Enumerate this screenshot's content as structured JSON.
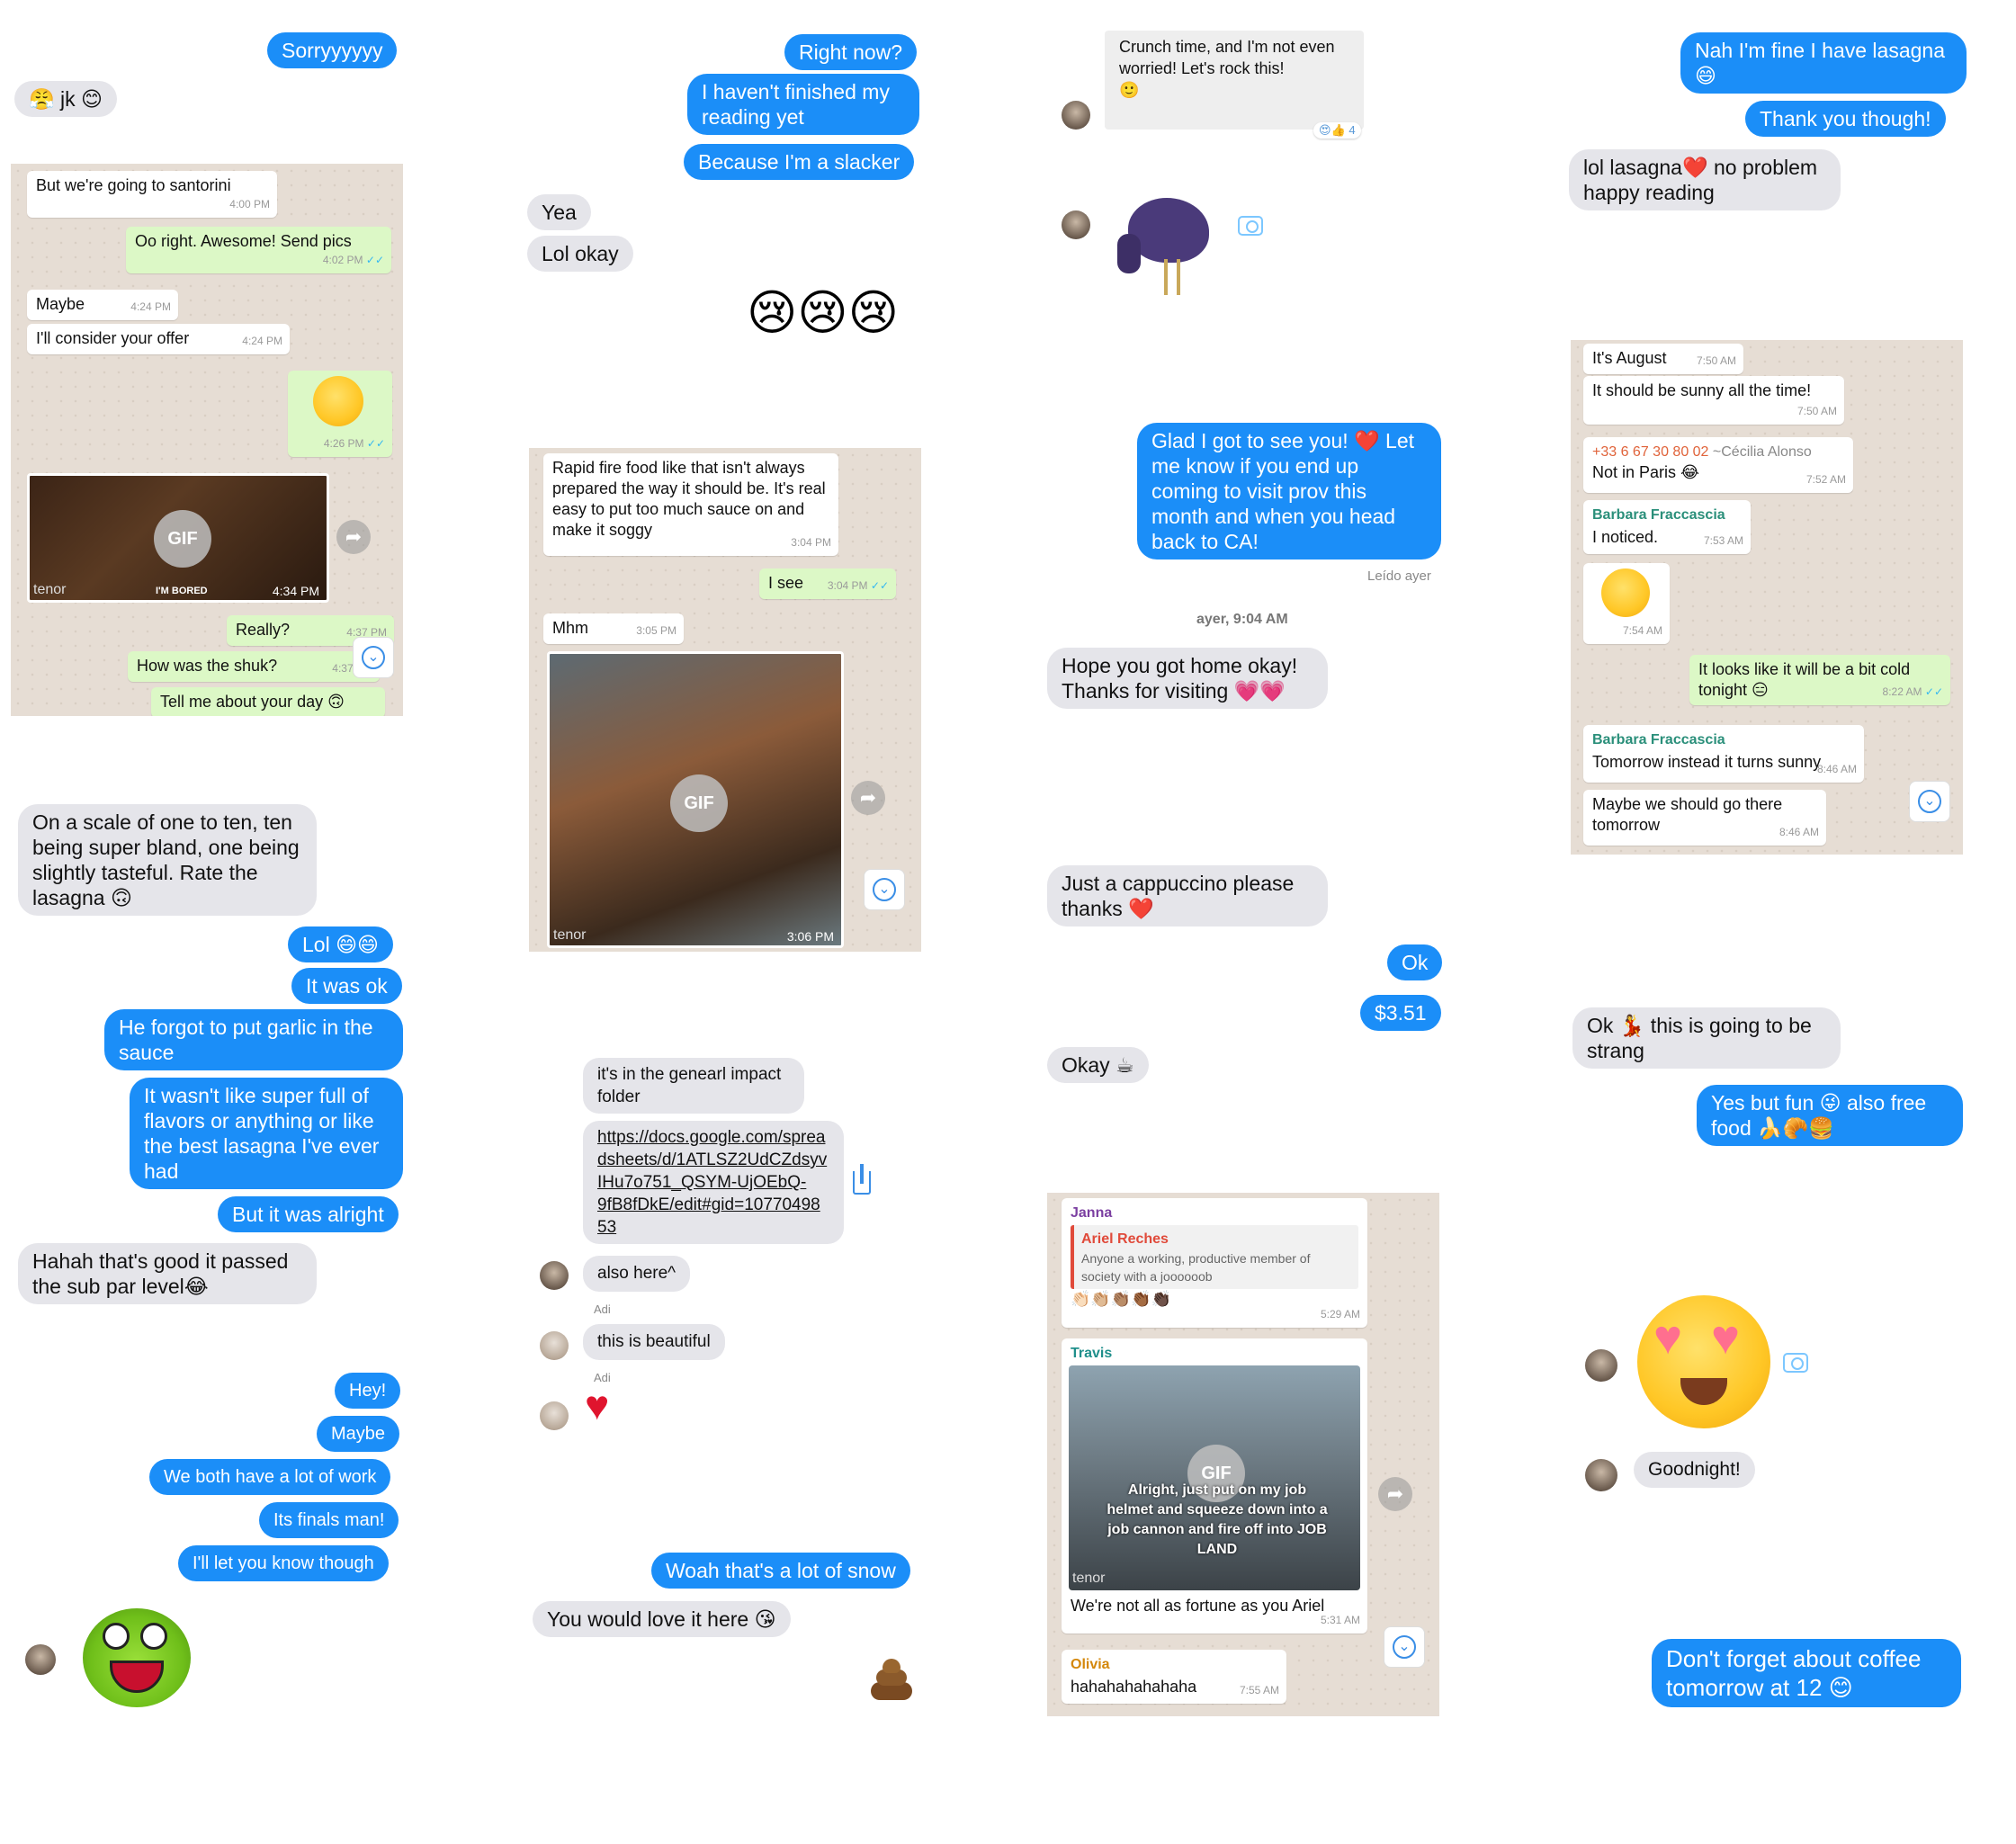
{
  "col1": {
    "m1": "Sorryyyyyy",
    "m2": "😤 jk 😊",
    "wa": {
      "b1": "But we're going to santorini",
      "t1": "4:00 PM",
      "b2": "Oo right. Awesome! Send pics",
      "t2": "4:02 PM",
      "b3": "Maybe",
      "t3": "4:24 PM",
      "b4": "I'll consider your offer",
      "t4": "4:24 PM",
      "emoji_t": "4:26 PM",
      "gif_label": "GIF",
      "gif_tenor": "tenor",
      "gif_caption": "I'M BORED",
      "gif_t": "4:34 PM",
      "b5": "Really?",
      "t5": "4:37 PM",
      "b6": "How was the shuk?",
      "t6": "4:37 PM",
      "b7": "Tell me about your day 🙃"
    },
    "c1": "On a scale of one to ten, ten being super bland, one being slightly tasteful. Rate the lasagna 🙃",
    "c2": "Lol 😄😄",
    "c3": "It was ok",
    "c4": "He forgot to put garlic in the sauce",
    "c5": "It wasn't like super full of flavors or anything or like the best lasagna I've ever had",
    "c6": "But it was alright",
    "c7": "Hahah that's good it passed the sub par level😂",
    "d1": "Hey!",
    "d2": "Maybe",
    "d3": "We both have a lot of work",
    "d4": "Its finals man!",
    "d5": "I'll let you know though"
  },
  "col2": {
    "m1": "Right now?",
    "m2": "I haven't finished my reading yet",
    "m3": "Because I'm a slacker",
    "m4": "Yea",
    "m5": "Lol okay",
    "cry": "😢😢😢",
    "wa": {
      "b1": "Rapid fire food like that isn't always prepared the way it should be. It's real easy to put too much sauce on and make it soggy",
      "t1": "3:04 PM",
      "b2": "I see",
      "t2": "3:04 PM",
      "b3": "Mhm",
      "t3": "3:05 PM",
      "gif_label": "GIF",
      "gif_tenor": "tenor",
      "gif_t": "3:06 PM"
    },
    "s1": "it's in the genearl impact folder",
    "s2": "https://docs.google.com/spreadsheets/d/1ATLSZ2UdCZdsyvIHu7o751_QSYM-UjOEbQ-9fB8fDkE/edit#gid=1077049853",
    "s3": "also here^",
    "sender": "Adi",
    "s4": "this is beautiful",
    "sender2": "Adi",
    "e1": "Woah that's a lot of snow",
    "e2": "You would love it here 😘"
  },
  "col3": {
    "m1": "Crunch time, and I'm not even worried! Let's rock this!",
    "m1_emoji": "🙂",
    "react": "😍👍 4",
    "b1": "Glad I got to see you! ❤️ Let me know if you end up coming to visit prov this month and when you head back to CA!",
    "read": "Leído ayer",
    "time": "ayer, 9:04 AM",
    "b2": "Hope you got home okay! Thanks for visiting 💗💗",
    "b3": "Just a cappuccino please thanks ❤️",
    "b4": "Ok",
    "b5": "$3.51",
    "b6": "Okay ☕",
    "wa": {
      "n1": "Janna",
      "q_name": "Ariel Reches",
      "q_text": "Anyone a working, productive member of society with a joooooob",
      "react": "👏🏻👏🏼👏🏽👏🏾👏🏿",
      "t1": "5:29 AM",
      "n2": "Travis",
      "gif_label": "GIF",
      "gif_caption": "Alright, just put on my job helmet and squeeze down into a job cannon and fire off into JOB LAND",
      "gif_tenor": "tenor",
      "b2": "We're not all as fortune as you Ariel",
      "t2": "5:31 AM",
      "n3": "Olivia",
      "b3": "hahahahahahaha",
      "t3": "7:55 AM"
    }
  },
  "col4": {
    "m1": "Nah I'm fine I have lasagna 😄",
    "m2": "Thank you though!",
    "m3": "lol lasagna❤️ no problem happy reading",
    "wa": {
      "b1": "It's August",
      "t1": "7:50 AM",
      "b2": "It should be sunny all the time!",
      "t2": "7:50 AM",
      "phone": "+33 6 67 30 80 02",
      "alias": "~Cécilia Alonso",
      "b3": "Not in Paris 😂",
      "t3": "7:52 AM",
      "n1": "Barbara Fraccascia",
      "b4": "I noticed.",
      "t4": "7:53 AM",
      "emoji_t": "7:54 AM",
      "b5": "It looks like it will be a bit cold tonight 😑",
      "t5": "8:22 AM",
      "n2": "Barbara Fraccascia",
      "b6": "Tomorrow instead it turns sunny",
      "t6": "8:46 AM",
      "b7": "Maybe we should go there tomorrow",
      "t7": "8:46 AM"
    },
    "c1": "Ok 💃 this is going to be strang",
    "c2": "Yes but fun 😜 also free food 🍌🥐🍔",
    "d1": "Goodnight!",
    "e1": "Don't forget about coffee tomorrow at 12 😊"
  }
}
